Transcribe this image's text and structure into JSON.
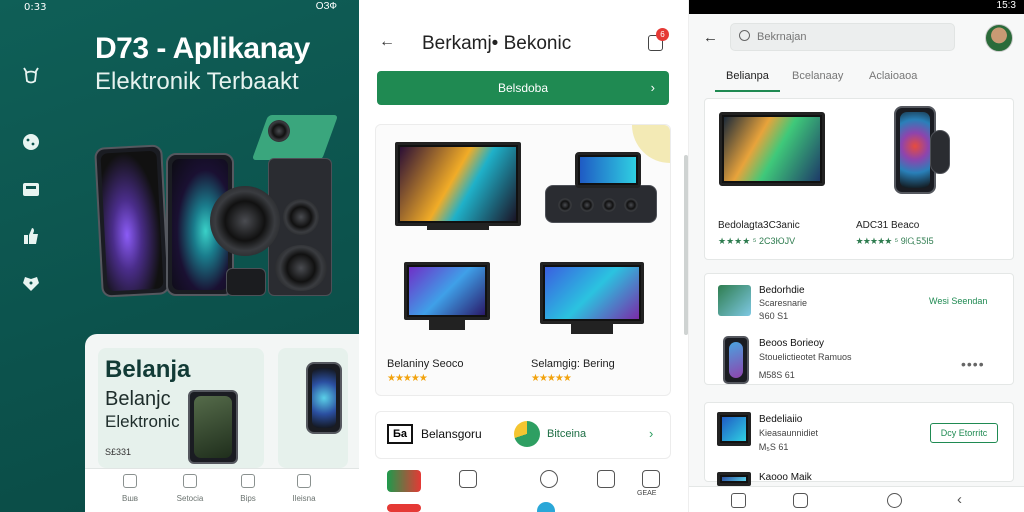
{
  "panel1": {
    "status_time": "0:33",
    "status_right": "ОЗФ",
    "hero_title": "D73 - Aplikanay",
    "hero_subtitle": "Elektronik Terbaakt",
    "sidebar_icons": [
      "deer-icon",
      "cookie-icon",
      "box-icon",
      "thumb-icon",
      "tag-icon"
    ],
    "card": {
      "title": "Belanja",
      "line1": "Belanjc",
      "line2": "Elektronic",
      "price": "S£331"
    },
    "nav": [
      {
        "label": "Вшв",
        "icon": "home-icon"
      },
      {
        "label": "Setocia",
        "icon": "category-icon"
      },
      {
        "label": "Bips",
        "icon": "list-icon"
      },
      {
        "label": "Ileisna",
        "icon": "profile-icon"
      }
    ]
  },
  "panel2": {
    "title": "Berkamj• Bekonic",
    "cart_count": "6",
    "cta_label": "Belsdoba",
    "products": [
      {
        "name": "Belaniny Seoco",
        "stars": "★★★★★"
      },
      {
        "name": "Selamgig: Bering",
        "stars": "★★★★★"
      }
    ],
    "brand_icon_text": "Ба",
    "brand_label": "Belansgoru",
    "green_label": "Bitceina",
    "bottom_labels": [
      "",
      "",
      "",
      "",
      "GEAE"
    ]
  },
  "panel3": {
    "status_time": "15:3",
    "search_placeholder": "Bekrnajan",
    "tabs": [
      "Belianpa",
      "Bcelanaay",
      "Aclaioaoa"
    ],
    "products": [
      {
        "name": "Bedolagta3C3anic",
        "rating": "★★★★ ⁵ 2C3ЮJV"
      },
      {
        "name": "ADC31 Beaco",
        "rating": "★★★★★ ⁵ 9∣Ꮹ5ƼΙ5"
      }
    ],
    "list": [
      {
        "title": "Bedorhdie",
        "sub1": "Scaresnarie",
        "sub2": "Ꮥ60 S1",
        "action": "Wesi Seendan"
      },
      {
        "title": "Beoos Borieoy",
        "sub1": "Stouelictieotet Ramuos",
        "sub2": "Ꮇ58S 61",
        "action": "••••"
      },
      {
        "title": "Bedeliaiio",
        "sub1": "Kieasaunnidiet",
        "sub2": "Ꮇ₅S 61",
        "action": "Dcy Etorritc"
      },
      {
        "title": "Kaooo Maik",
        "sub1": "",
        "sub2": "",
        "action": ""
      }
    ]
  },
  "colors": {
    "teal_bg": "#0c534d",
    "accent_green": "#1f8a52",
    "star": "#f2a30f",
    "badge_red": "#e53935"
  }
}
